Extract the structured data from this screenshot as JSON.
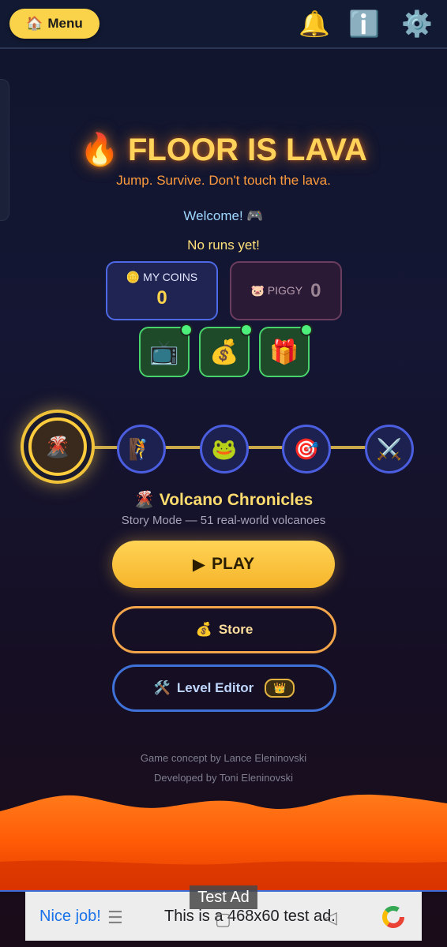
{
  "header": {
    "menu_icon": "🏠",
    "menu_label": "Menu",
    "bell_icon": "🔔",
    "info_icon": "ℹ️",
    "settings_icon": "⚙️"
  },
  "hero": {
    "flame_icon": "🔥",
    "title": "FLOOR IS LAVA",
    "subtitle": "Jump. Survive. Don't touch the lava."
  },
  "status": {
    "welcome": "Welcome! 🎮",
    "runs": "No runs yet!"
  },
  "coins": {
    "icon": "🪙",
    "label": "MY COINS",
    "value": "0"
  },
  "piggy": {
    "icon": "🐷",
    "label": "PIGGY",
    "value": "0"
  },
  "rewards": [
    {
      "icon": "📺"
    },
    {
      "icon": "💰"
    },
    {
      "icon": "🎁"
    }
  ],
  "modes": [
    {
      "icon": "🌋"
    },
    {
      "icon": "🧗"
    },
    {
      "icon": "🐸"
    },
    {
      "icon": "🎯"
    },
    {
      "icon": "⚔️"
    }
  ],
  "selected_mode": {
    "icon": "🌋",
    "title": "Volcano Chronicles",
    "desc": "Story Mode — 51 real-world volcanoes"
  },
  "buttons": {
    "play_icon": "▶",
    "play": "PLAY",
    "store_icon": "💰",
    "store": "Store",
    "editor_icon": "🛠️",
    "editor": "Level Editor",
    "editor_badge": "👑"
  },
  "credits": {
    "concept": "Game concept by Lance Eleninovski",
    "developer": "Developed by Toni Eleninovski"
  },
  "ad": {
    "label": "Test Ad",
    "headline": "Nice job!",
    "text": "This is a 468x60 test ad."
  },
  "colors": {
    "accent_gold": "#ffd25a",
    "lava": "#ff5a00",
    "blue_border": "#4b5ee0"
  }
}
